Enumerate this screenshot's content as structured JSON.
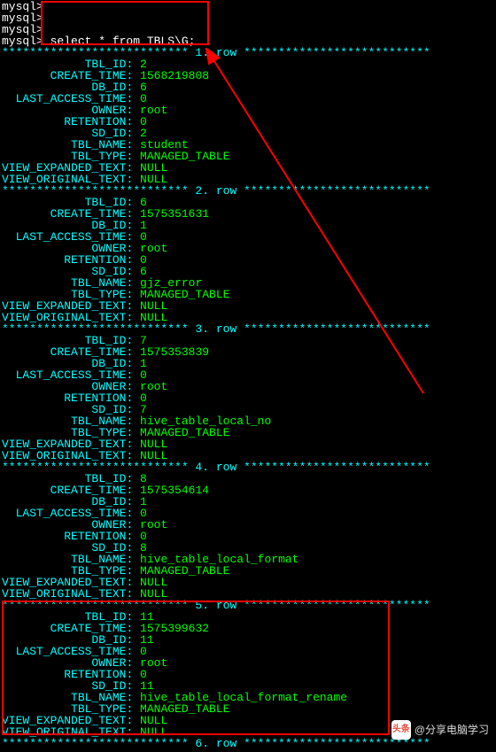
{
  "prompts": [
    "mysql>",
    "mysql>",
    "mysql>",
    "mysql> select * from TBLS\\G;"
  ],
  "row_separator_prefix": "***************************",
  "row_separator_suffix": "***************************",
  "row_label": ". row ",
  "fields": [
    "TBL_ID",
    "CREATE_TIME",
    "DB_ID",
    "LAST_ACCESS_TIME",
    "OWNER",
    "RETENTION",
    "SD_ID",
    "TBL_NAME",
    "TBL_TYPE",
    "VIEW_EXPANDED_TEXT",
    "VIEW_ORIGINAL_TEXT"
  ],
  "rows": [
    {
      "n": "1",
      "TBL_ID": "2",
      "CREATE_TIME": "1568219808",
      "DB_ID": "6",
      "LAST_ACCESS_TIME": "0",
      "OWNER": "root",
      "RETENTION": "0",
      "SD_ID": "2",
      "TBL_NAME": "student",
      "TBL_TYPE": "MANAGED_TABLE",
      "VIEW_EXPANDED_TEXT": "NULL",
      "VIEW_ORIGINAL_TEXT": "NULL"
    },
    {
      "n": "2",
      "TBL_ID": "6",
      "CREATE_TIME": "1575351631",
      "DB_ID": "1",
      "LAST_ACCESS_TIME": "0",
      "OWNER": "root",
      "RETENTION": "0",
      "SD_ID": "6",
      "TBL_NAME": "gjz_error",
      "TBL_TYPE": "MANAGED_TABLE",
      "VIEW_EXPANDED_TEXT": "NULL",
      "VIEW_ORIGINAL_TEXT": "NULL"
    },
    {
      "n": "3",
      "TBL_ID": "7",
      "CREATE_TIME": "1575353839",
      "DB_ID": "1",
      "LAST_ACCESS_TIME": "0",
      "OWNER": "root",
      "RETENTION": "0",
      "SD_ID": "7",
      "TBL_NAME": "hive_table_local_no",
      "TBL_TYPE": "MANAGED_TABLE",
      "VIEW_EXPANDED_TEXT": "NULL",
      "VIEW_ORIGINAL_TEXT": "NULL"
    },
    {
      "n": "4",
      "TBL_ID": "8",
      "CREATE_TIME": "1575354614",
      "DB_ID": "1",
      "LAST_ACCESS_TIME": "0",
      "OWNER": "root",
      "RETENTION": "0",
      "SD_ID": "8",
      "TBL_NAME": "hive_table_local_format",
      "TBL_TYPE": "MANAGED_TABLE",
      "VIEW_EXPANDED_TEXT": "NULL",
      "VIEW_ORIGINAL_TEXT": "NULL"
    },
    {
      "n": "5",
      "TBL_ID": "11",
      "CREATE_TIME": "1575399632",
      "DB_ID": "11",
      "LAST_ACCESS_TIME": "0",
      "OWNER": "root",
      "RETENTION": "0",
      "SD_ID": "11",
      "TBL_NAME": "hive_table_local_format_rename",
      "TBL_TYPE": "MANAGED_TABLE",
      "VIEW_EXPANDED_TEXT": "NULL",
      "VIEW_ORIGINAL_TEXT": "NULL"
    }
  ],
  "trailing_separator_n": "6",
  "watermark": {
    "icon_text": "头条",
    "text": "@分享电脑学习"
  }
}
